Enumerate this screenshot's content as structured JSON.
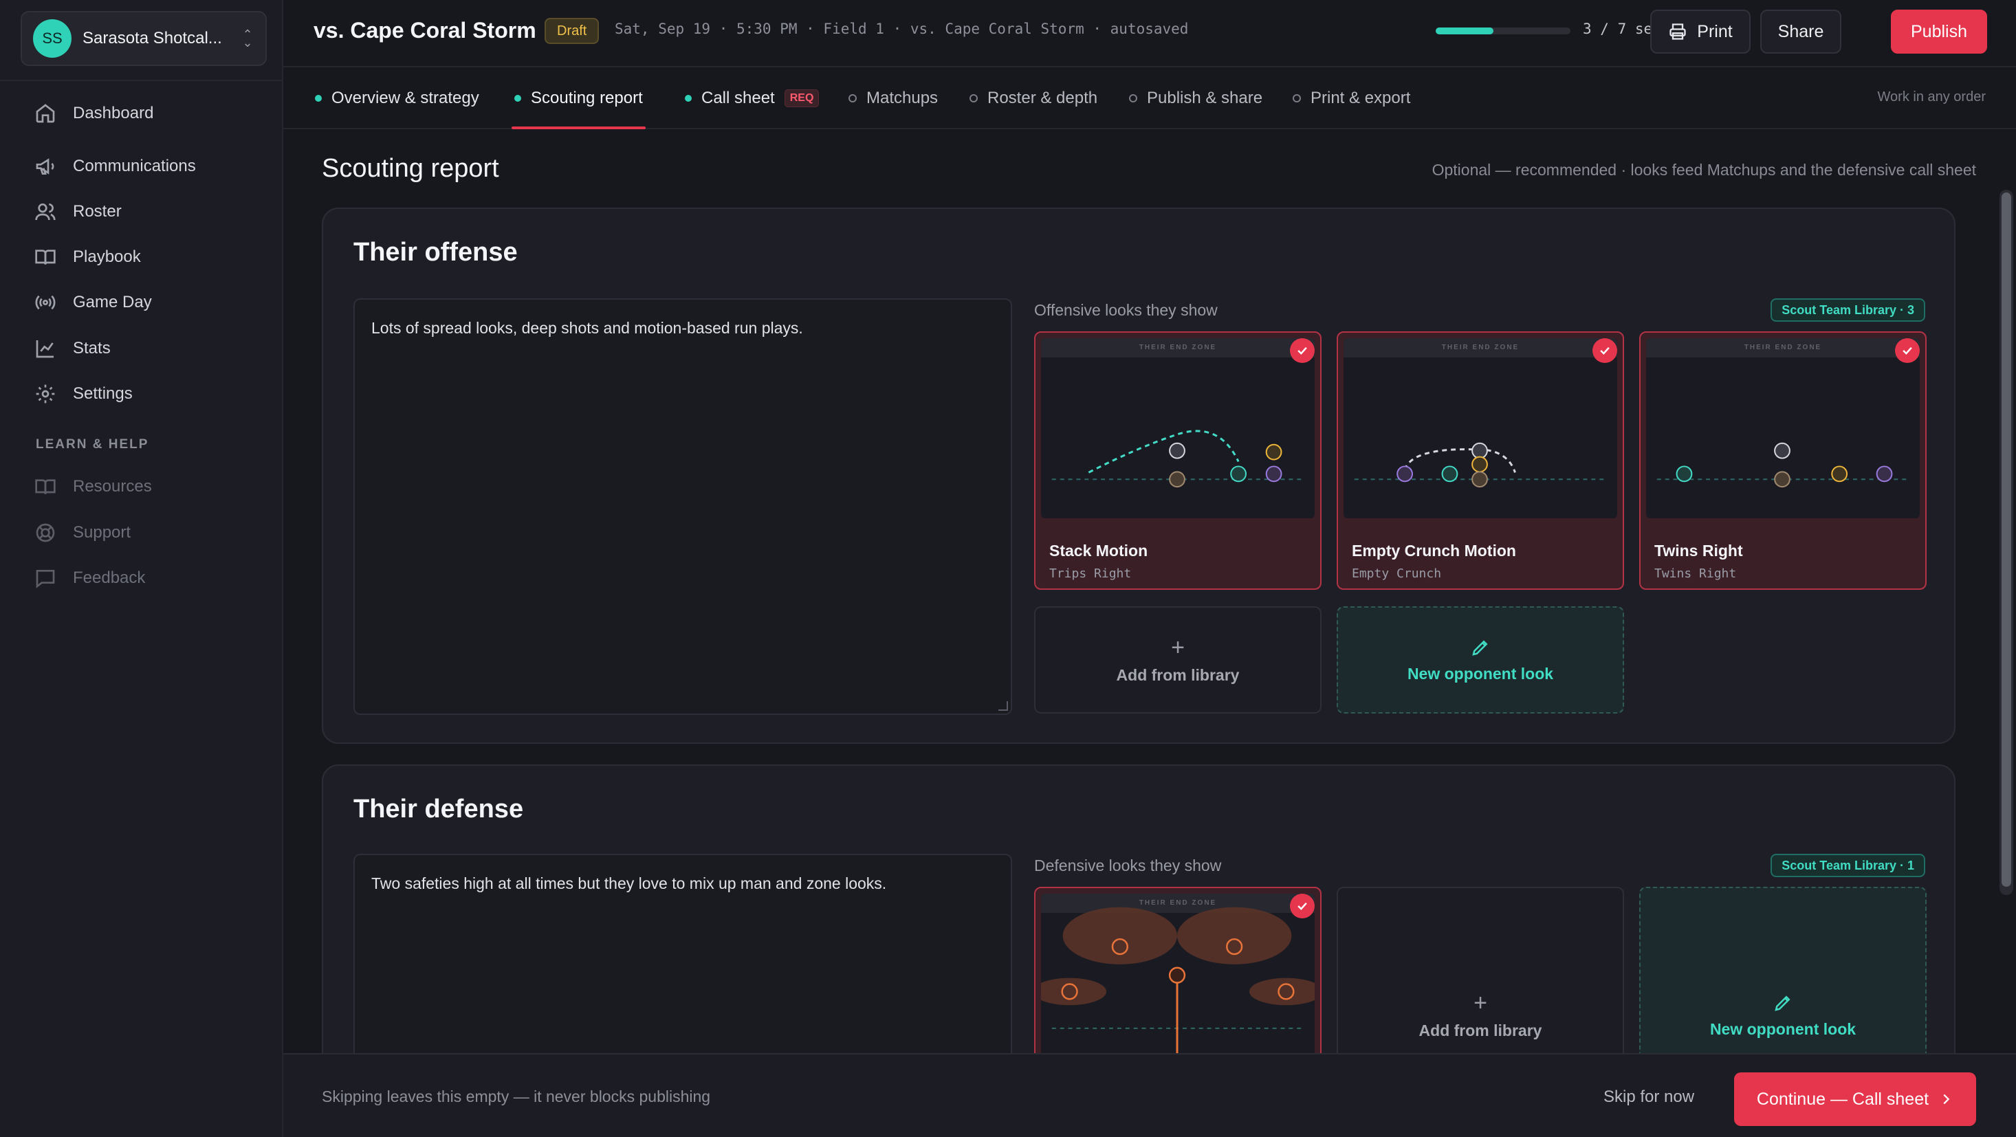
{
  "workspace": {
    "initials": "SS",
    "name": "Sarasota Shotcal..."
  },
  "nav": {
    "items": [
      {
        "label": "Dashboard",
        "icon": "home-icon"
      },
      {
        "label": "Communications",
        "icon": "megaphone-icon"
      },
      {
        "label": "Roster",
        "icon": "users-icon"
      },
      {
        "label": "Playbook",
        "icon": "book-icon"
      },
      {
        "label": "Game Day",
        "icon": "broadcast-icon"
      },
      {
        "label": "Stats",
        "icon": "chart-icon"
      },
      {
        "label": "Settings",
        "icon": "gear-icon"
      }
    ],
    "section_label": "LEARN & HELP",
    "help_items": [
      {
        "label": "Resources",
        "icon": "book-icon"
      },
      {
        "label": "Support",
        "icon": "lifebuoy-icon"
      },
      {
        "label": "Feedback",
        "icon": "message-icon"
      }
    ]
  },
  "header": {
    "title": "vs. Cape Coral Storm",
    "status_badge": "Draft",
    "meta": "Sat, Sep 19 · 5:30 PM · Field 1 · vs. Cape Coral Storm · autosaved",
    "progress": {
      "done": 3,
      "total": 7,
      "text": "3 / 7 set"
    },
    "print_label": "Print",
    "share_label": "Share",
    "publish_label": "Publish",
    "accent": "#e5364d",
    "success": "#2fd1b7"
  },
  "tabs": {
    "items": [
      {
        "label": "Overview & strategy",
        "state": "done"
      },
      {
        "label": "Scouting report",
        "state": "active"
      },
      {
        "label": "Call sheet",
        "state": "done",
        "badge": "REQ"
      },
      {
        "label": "Matchups",
        "state": "todo"
      },
      {
        "label": "Roster & depth",
        "state": "todo"
      },
      {
        "label": "Publish & share",
        "state": "todo"
      },
      {
        "label": "Print & export",
        "state": "todo"
      }
    ],
    "hint": "Work in any order"
  },
  "page": {
    "title": "Scouting report",
    "hint": "Optional — recommended · looks feed Matchups and the defensive call sheet"
  },
  "offense": {
    "title": "Their offense",
    "notes": "Lots of spread looks, deep shots and motion-based run plays.",
    "looks_label": "Offensive looks they show",
    "library_badge": "Scout Team Library · 3",
    "endzone_label": "THEIR END ZONE",
    "cards": [
      {
        "name": "Stack Motion",
        "formation": "Trips Right"
      },
      {
        "name": "Empty Crunch Motion",
        "formation": "Empty Crunch"
      },
      {
        "name": "Twins Right",
        "formation": "Twins Right"
      }
    ],
    "add_label": "Add from library",
    "new_label": "New opponent look"
  },
  "defense": {
    "title": "Their defense",
    "notes": "Two safeties high at all times but they love to mix up man and zone looks.",
    "looks_label": "Defensive looks they show",
    "library_badge": "Scout Team Library · 1",
    "endzone_label": "THEIR END ZONE",
    "add_label": "Add from library",
    "new_label": "New opponent look"
  },
  "footer": {
    "hint": "Skipping leaves this empty — it never blocks publishing",
    "skip_label": "Skip for now",
    "continue_label": "Continue — Call sheet"
  }
}
